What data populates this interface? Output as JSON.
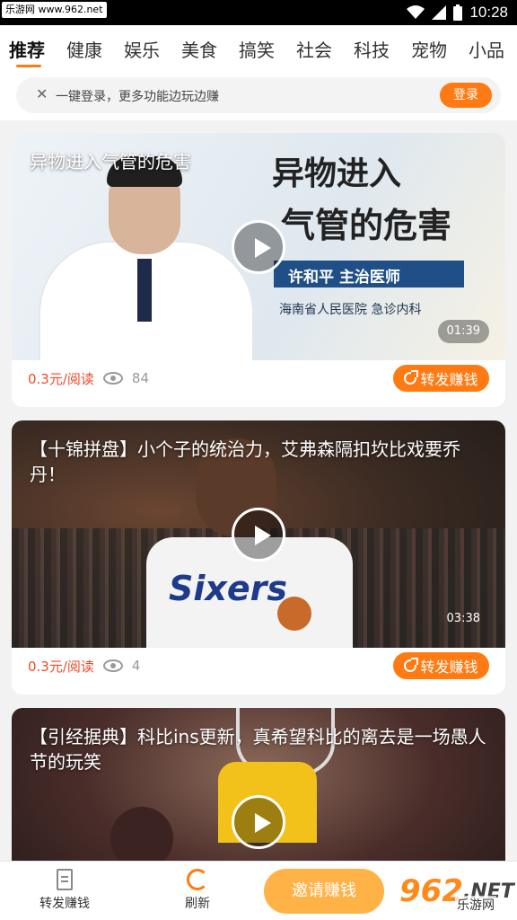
{
  "status_bar": {
    "watermark": "乐游网 www.962.net",
    "time": "10:28",
    "icons": [
      "wifi-icon",
      "signal-icon",
      "battery-icon"
    ]
  },
  "tabs": [
    {
      "label": "推荐",
      "active": true
    },
    {
      "label": "健康"
    },
    {
      "label": "娱乐"
    },
    {
      "label": "美食"
    },
    {
      "label": "搞笑"
    },
    {
      "label": "社会"
    },
    {
      "label": "科技"
    },
    {
      "label": "宠物"
    },
    {
      "label": "小品"
    }
  ],
  "login_banner": {
    "text": "一键登录，更多功能边玩边赚",
    "button": "登录"
  },
  "cards": [
    {
      "title": "异物进入气管的危害",
      "image_text": {
        "headline_1": "异物进入",
        "headline_2": "气管的危害",
        "doctor": "许和平  主治医师",
        "hospital": "海南省人民医院    急诊内科"
      },
      "duration": "01:39",
      "price": "0.3元/阅读",
      "views": "84",
      "share_label": "转发赚钱"
    },
    {
      "title": "【十锦拼盘】小个子的统治力，艾弗森隔扣坎比戏要乔丹！",
      "jersey_text": "Sixers",
      "duration": "03:38",
      "price": "0.3元/阅读",
      "views": "4",
      "share_label": "转发赚钱"
    },
    {
      "title": "【引经据典】科比ins更新，真希望科比的离去是一场愚人节的玩笑"
    }
  ],
  "bottom_nav": {
    "share": "转发赚钱",
    "refresh": "刷新",
    "invite": "邀请赚钱"
  },
  "watermark_bottom": {
    "number": "962",
    "suffix": ".NET",
    "site": "乐游网"
  },
  "colors": {
    "accent": "#ff7a12",
    "price": "#ee4a2a",
    "invite": "#ffb347"
  }
}
